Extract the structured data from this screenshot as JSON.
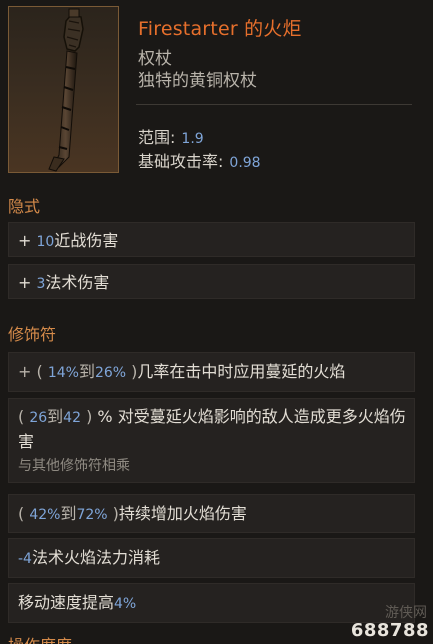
{
  "item": {
    "name": "Firestarter 的火炬",
    "type": "权杖",
    "base": "独特的黄铜权杖",
    "stats": [
      {
        "label": "范围:",
        "value": "1.9"
      },
      {
        "label": "基础攻击率:",
        "value": "0.98"
      }
    ]
  },
  "implicit": {
    "title": "隐式",
    "rows": [
      {
        "prefix": "+ ",
        "num": "10",
        "text": "近战伤害"
      },
      {
        "prefix": "+ ",
        "num": "3",
        "text": "法术伤害"
      }
    ]
  },
  "affixes": {
    "title": "修饰符",
    "row1": {
      "p1": "+ ( ",
      "n1": "14%",
      "mid": "到",
      "n2": "26%",
      "p2": " )",
      "text": "几率在击中时应用蔓延的火焰"
    },
    "row2": {
      "p1": "( ",
      "n1": "26",
      "mid": "到",
      "n2": "42",
      "p2": " ) ",
      "text": "% 对受蔓延火焰影响的敌人造成更多火焰伤害",
      "note": "与其他修饰符相乘"
    },
    "row3": {
      "p1": "( ",
      "n1": "42%",
      "mid": "到",
      "n2": "72%",
      "p2": " )",
      "text": "持续增加火焰伤害"
    },
    "row4": {
      "num": "-4",
      "text": "法术火焰法力消耗"
    },
    "row5": {
      "text": "移动速度提高",
      "num": "4%"
    }
  },
  "next_section": "操作度度",
  "watermark": {
    "line1": "游侠网",
    "line2": "688788"
  },
  "colors": {
    "title": "#e66f2c",
    "section": "#d48a4a",
    "number": "#7fa5d8"
  },
  "icons": {
    "item": "brass-scepter-torch"
  }
}
